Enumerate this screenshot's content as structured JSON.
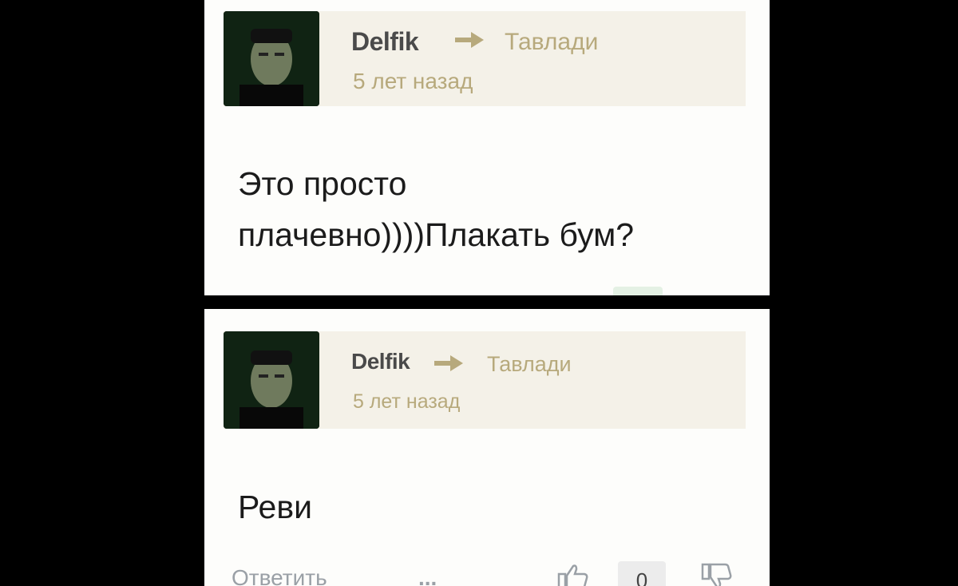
{
  "comments": [
    {
      "author": "Delfik",
      "reply_to": "Тавлади",
      "time": "5 лет назад",
      "text_lines": [
        "Это просто",
        "плачевно))))Плакать бум?"
      ]
    },
    {
      "author": "Delfik",
      "reply_to": "Тавлади",
      "time": "5 лет назад",
      "text_lines": [
        "Реви"
      ],
      "actions": {
        "reply_label": "Ответить",
        "more_label": "...",
        "score": "0"
      }
    }
  ],
  "icons": {
    "arrow": "arrow-right-icon",
    "like": "thumbs-up-icon",
    "dislike": "thumbs-down-icon"
  },
  "colors": {
    "header_bg": "#f4f1e8",
    "meta_text": "#b7a97c",
    "author_text": "#4a4a4a"
  }
}
